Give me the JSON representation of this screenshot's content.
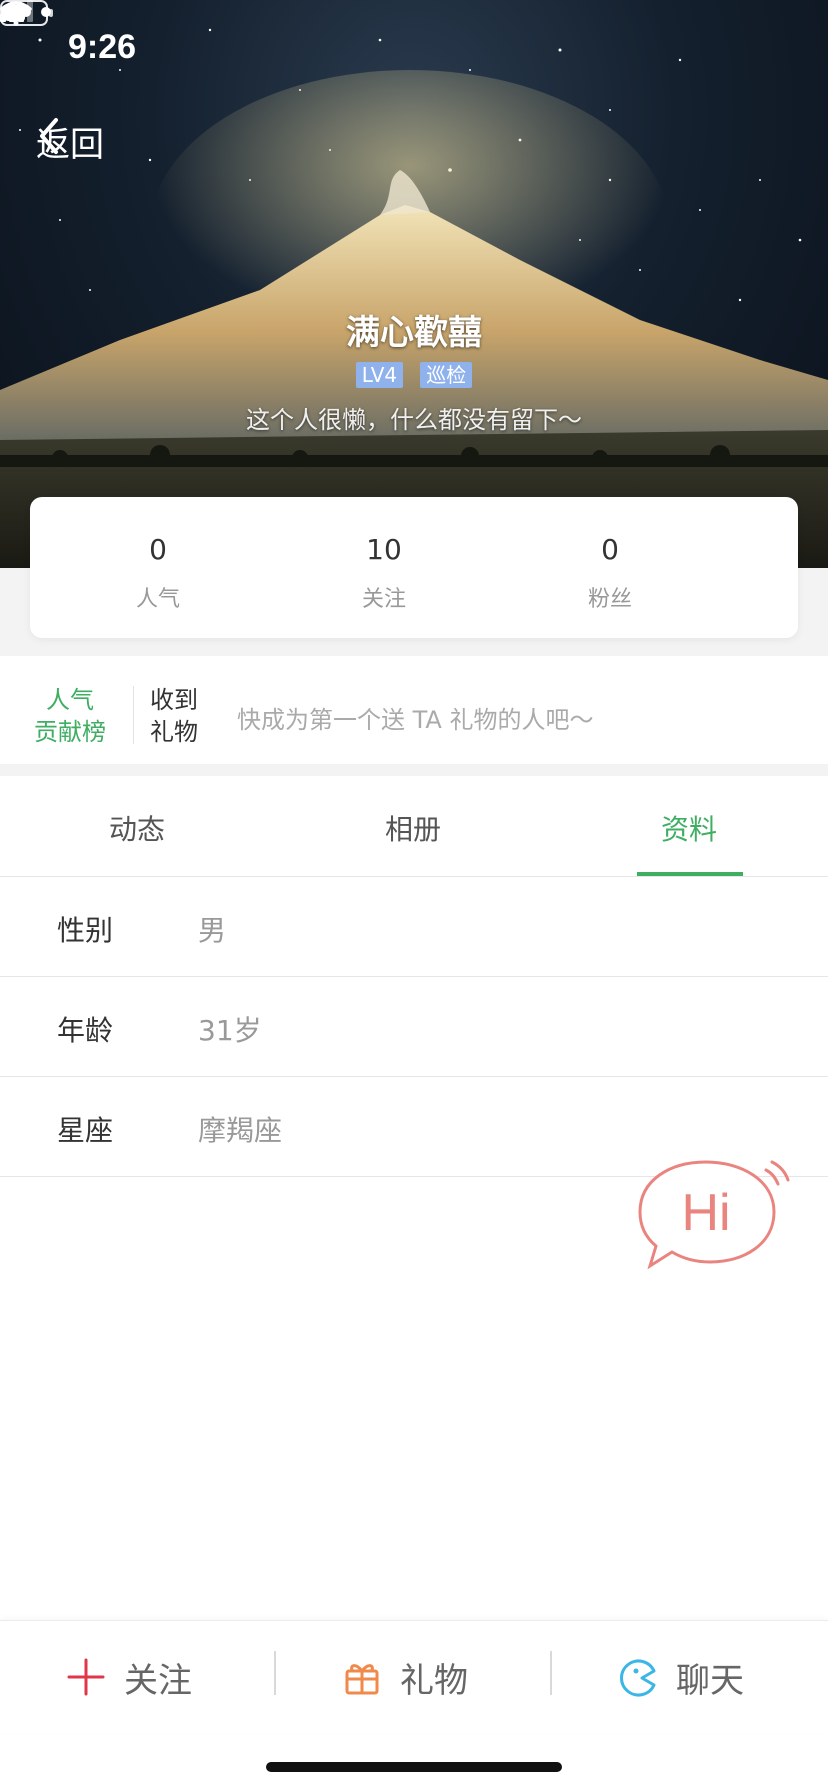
{
  "status_bar": {
    "time": "9:26"
  },
  "nav": {
    "back_label": "返回",
    "more_icon": "more-dots-icon"
  },
  "profile": {
    "nickname": "满心歡囍",
    "level_badge": "LV4",
    "role_badge": "巡检",
    "bio": "这个人很懒，什么都没有留下～"
  },
  "stats": [
    {
      "value": "0",
      "label": "人气"
    },
    {
      "value": "10",
      "label": "关注"
    },
    {
      "value": "0",
      "label": "粉丝"
    }
  ],
  "gifts": {
    "rank_line1": "人气",
    "rank_line2": "贡献榜",
    "received_line1": "收到",
    "received_line2": "礼物",
    "empty_text": "快成为第一个送 TA 礼物的人吧～"
  },
  "tabs": [
    {
      "label": "动态"
    },
    {
      "label": "相册"
    },
    {
      "label": "资料",
      "active": true
    }
  ],
  "info": [
    {
      "key": "性别",
      "value": "男"
    },
    {
      "key": "年龄",
      "value": "31岁"
    },
    {
      "key": "星座",
      "value": "摩羯座"
    }
  ],
  "hi_button": {
    "text": "Hi"
  },
  "actions": [
    {
      "label": "关注",
      "icon": "plus-icon",
      "color": "#e0364a"
    },
    {
      "label": "礼物",
      "icon": "gift-icon",
      "color": "#f08a4b"
    },
    {
      "label": "聊天",
      "icon": "chat-icon",
      "color": "#3cb6e6"
    }
  ],
  "colors": {
    "accent": "#3fae63",
    "badge": "#8fb1ec",
    "hi": "#e9847f"
  }
}
